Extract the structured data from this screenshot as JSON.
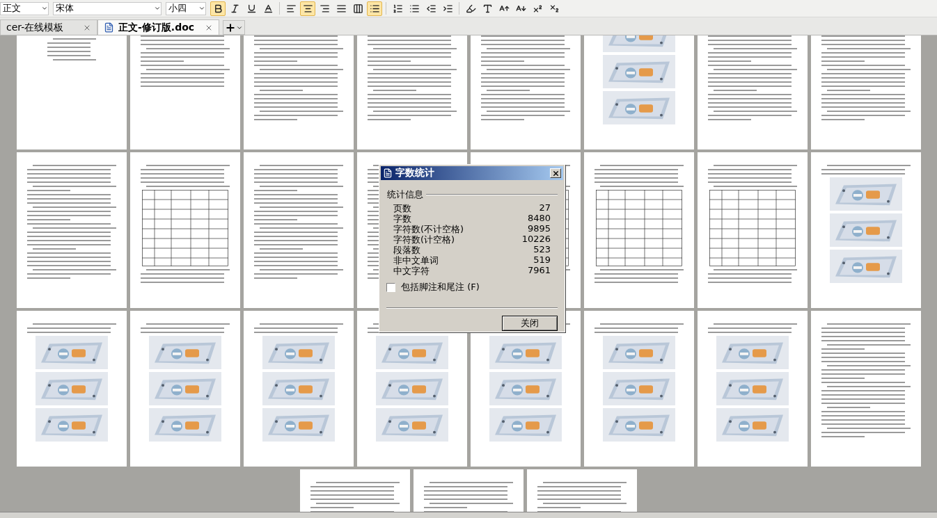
{
  "toolbar": {
    "style": "正文",
    "font": "宋体",
    "size": "小四",
    "buttons": [
      {
        "kind": "bold",
        "selected": true
      },
      {
        "kind": "italic",
        "selected": false
      },
      {
        "kind": "underline",
        "selected": false
      },
      {
        "kind": "effect",
        "selected": false
      },
      {
        "kind": "align-left",
        "selected": false
      },
      {
        "kind": "align-center",
        "selected": true
      },
      {
        "kind": "align-right",
        "selected": false
      },
      {
        "kind": "justify",
        "selected": false
      },
      {
        "kind": "distribute",
        "selected": false
      },
      {
        "kind": "line-spacing",
        "selected": true
      },
      {
        "kind": "numbered-list",
        "selected": false
      },
      {
        "kind": "bullet-list",
        "selected": false
      },
      {
        "kind": "outdent",
        "selected": false
      },
      {
        "kind": "indent",
        "selected": false
      },
      {
        "kind": "highlight",
        "selected": false
      },
      {
        "kind": "font-color",
        "selected": false
      },
      {
        "kind": "grow",
        "selected": false
      },
      {
        "kind": "shrink",
        "selected": false
      },
      {
        "kind": "superscript",
        "selected": false
      },
      {
        "kind": "subscript",
        "selected": false
      }
    ]
  },
  "tabs": [
    {
      "label": "cer-在线模板",
      "selected": false
    },
    {
      "label": "正文-修订版.doc",
      "selected": true
    }
  ],
  "pages": [
    {
      "kind": "cover"
    },
    {
      "kind": "toc"
    },
    {
      "kind": "text"
    },
    {
      "kind": "text"
    },
    {
      "kind": "text"
    },
    {
      "kind": "images"
    },
    {
      "kind": "text"
    },
    {
      "kind": "text"
    },
    {
      "kind": "text"
    },
    {
      "kind": "table"
    },
    {
      "kind": "text"
    },
    {
      "kind": "text"
    },
    {
      "kind": "table"
    },
    {
      "kind": "table"
    },
    {
      "kind": "table"
    },
    {
      "kind": "images"
    },
    {
      "kind": "images"
    },
    {
      "kind": "images"
    },
    {
      "kind": "images"
    },
    {
      "kind": "images"
    },
    {
      "kind": "images"
    },
    {
      "kind": "images"
    },
    {
      "kind": "images"
    },
    {
      "kind": "text"
    },
    {
      "kind": "text"
    },
    {
      "kind": "text"
    },
    {
      "kind": "text"
    }
  ],
  "dialog": {
    "title": "字数统计",
    "group": "统计信息",
    "stats": [
      {
        "label": "页数",
        "value": "27"
      },
      {
        "label": "字数",
        "value": "8480"
      },
      {
        "label": "字符数(不计空格)",
        "value": "9895"
      },
      {
        "label": "字符数(计空格)",
        "value": "10226"
      },
      {
        "label": "段落数",
        "value": "523"
      },
      {
        "label": "非中文单词",
        "value": "519"
      },
      {
        "label": "中文字符",
        "value": "7961"
      }
    ],
    "include_footnotes": {
      "label": "包括脚注和尾注 (F)",
      "checked": false
    },
    "button": "关闭"
  }
}
